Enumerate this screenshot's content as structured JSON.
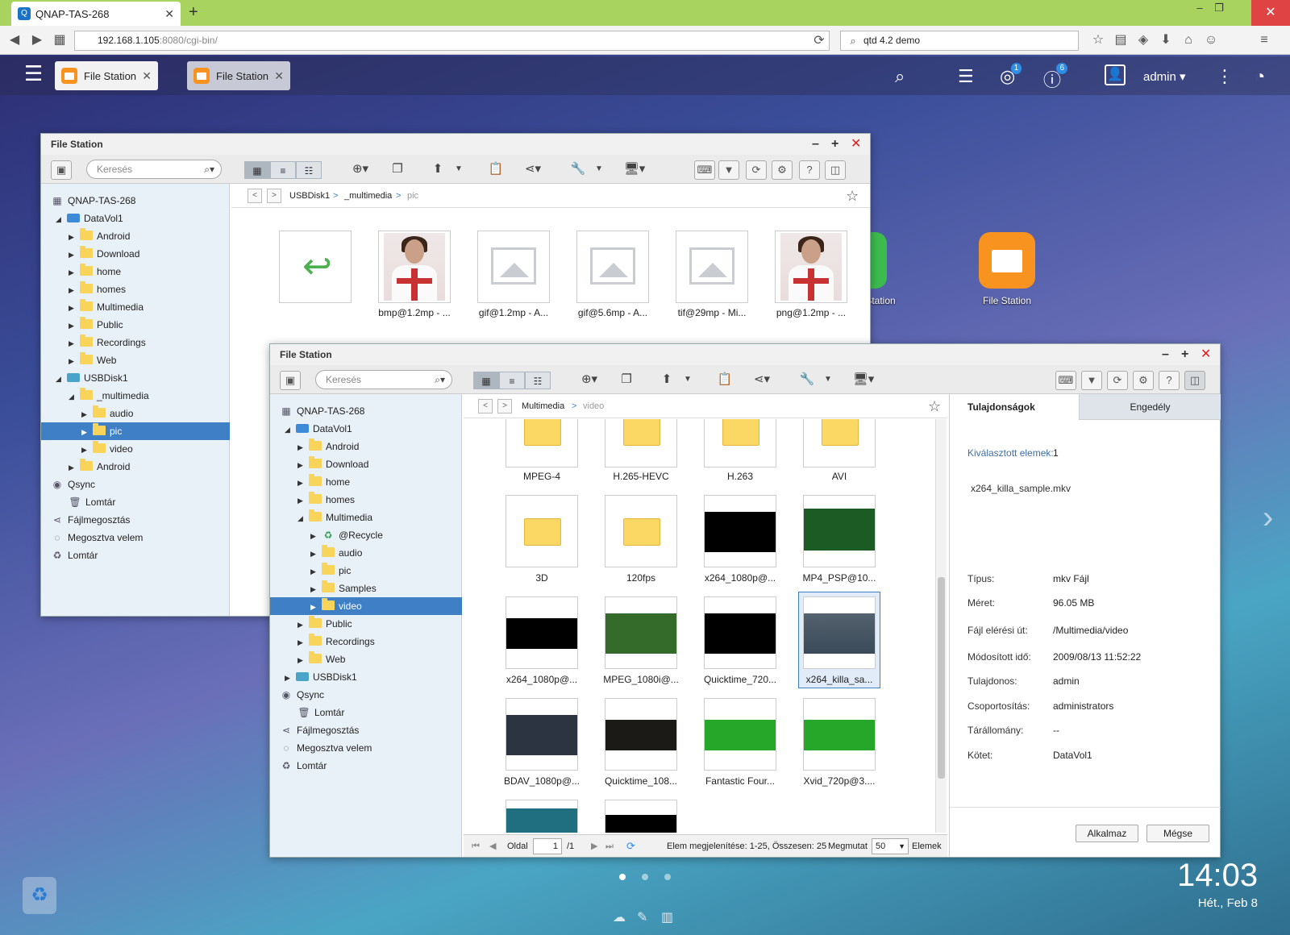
{
  "browser": {
    "tab_title": "QNAP-TAS-268",
    "url_host": "192.168.1.105",
    "url_rest": ":8080/cgi-bin/",
    "search_value": "qtd 4.2 demo"
  },
  "qts": {
    "tabs": [
      {
        "label": "File Station"
      },
      {
        "label": "File Station"
      }
    ],
    "user": "admin ▾",
    "notification_badge": "1",
    "info_badge": "6",
    "clock_time": "14:03",
    "clock_date": "Hét., Feb 8",
    "desktop_icons": [
      {
        "label": "Station"
      },
      {
        "label": "File Station"
      }
    ]
  },
  "win1": {
    "title": "File Station",
    "search_placeholder": "Keresés",
    "breadcrumb": [
      "USBDisk1",
      "_multimedia",
      "pic"
    ],
    "tree": [
      "QNAP-TAS-268",
      "DataVol1",
      "Android",
      "Download",
      "home",
      "homes",
      "Multimedia",
      "Public",
      "Recordings",
      "Web",
      "USBDisk1",
      "_multimedia",
      "audio",
      "pic",
      "video",
      "Android",
      "Qsync",
      "Lomtár",
      "Fájlmegosztás",
      "Megosztva velem",
      "Lomtár"
    ],
    "files": [
      "",
      "bmp@1.2mp - ...",
      "gif@1.2mp - A...",
      "gif@5.6mp - A...",
      "tif@29mp - Mi...",
      "png@1.2mp - ..."
    ]
  },
  "win2": {
    "title": "File Station",
    "search_placeholder": "Keresés",
    "breadcrumb": [
      "Multimedia",
      "video"
    ],
    "tree": [
      "QNAP-TAS-268",
      "DataVol1",
      "Android",
      "Download",
      "home",
      "homes",
      "Multimedia",
      "@Recycle",
      "audio",
      "pic",
      "Samples",
      "video",
      "Public",
      "Recordings",
      "Web",
      "USBDisk1",
      "Qsync",
      "Lomtár",
      "Fájlmegosztás",
      "Megosztva velem",
      "Lomtár"
    ],
    "files": [
      "MPEG-4",
      "H.265-HEVC",
      "H.263",
      "AVI",
      "3D",
      "120fps",
      "x264_1080p@...",
      "MP4_PSP@10...",
      "x264_1080p@...",
      "MPEG_1080i@...",
      "Quicktime_720...",
      "x264_killa_sa...",
      "BDAV_1080p@...",
      "Quicktime_108...",
      "Fantastic Four...",
      "Xvid_720p@3...."
    ],
    "footer": {
      "page_label": "Oldal",
      "page_value": "1",
      "page_total": "/1",
      "display_text": "Elem megjelenítése: 1-25, Összesen: 25",
      "show_label": "Megmutat",
      "show_value": "50",
      "items_label": "Elemek"
    },
    "properties": {
      "tab_props": "Tulajdonságok",
      "tab_perm": "Engedély",
      "selected_label": "Kiválasztott elemek:",
      "selected_value": "1",
      "filename": "x264_killa_sample.mkv",
      "rows": [
        {
          "label": "Típus:",
          "value": "mkv Fájl"
        },
        {
          "label": "Méret:",
          "value": "96.05 MB"
        },
        {
          "label": "Fájl elérési út:",
          "value": "/Multimedia/video"
        },
        {
          "label": "Módosított idő:",
          "value": "2009/08/13 11:52:22"
        },
        {
          "label": "Tulajdonos:",
          "value": "admin"
        },
        {
          "label": "Csoportosítás:",
          "value": "administrators"
        },
        {
          "label": "Tárállomány:",
          "value": "--"
        },
        {
          "label": "Kötet:",
          "value": "DataVol1"
        }
      ],
      "apply": "Alkalmaz",
      "cancel": "Mégse"
    }
  },
  "colors": {
    "selection": "#3e7fc6",
    "browser_tabbar": "#a9d35f",
    "folder": "#f8d45a"
  }
}
